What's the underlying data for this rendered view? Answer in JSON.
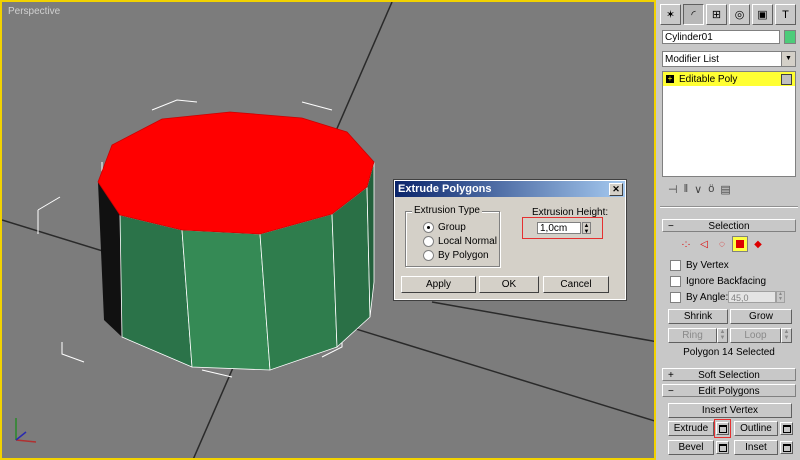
{
  "viewport": {
    "label": "Perspective"
  },
  "dialog": {
    "title": "Extrude Polygons",
    "close": "✕",
    "extrusion_type": {
      "label": "Extrusion Type",
      "options": [
        "Group",
        "Local Normal",
        "By Polygon"
      ],
      "selected": "Group"
    },
    "extrusion_height": {
      "label": "Extrusion Height:",
      "value": "1,0cm"
    },
    "buttons": {
      "apply": "Apply",
      "ok": "OK",
      "cancel": "Cancel"
    }
  },
  "panel": {
    "object_name": "Cylinder01",
    "object_color": "#4ccc7a",
    "modifier_list": "Modifier List",
    "stack": {
      "items": [
        "Editable Poly"
      ]
    },
    "selection": {
      "title": "Selection",
      "by_vertex": "By Vertex",
      "ignore_backfacing": "Ignore Backfacing",
      "by_angle": "By Angle:",
      "angle_value": "45,0",
      "shrink": "Shrink",
      "grow": "Grow",
      "ring": "Ring",
      "loop": "Loop",
      "status": "Polygon 14 Selected"
    },
    "soft_selection": {
      "title": "Soft Selection"
    },
    "edit_polygons": {
      "title": "Edit Polygons",
      "insert_vertex": "Insert Vertex",
      "extrude": "Extrude",
      "outline": "Outline",
      "bevel": "Bevel",
      "inset": "Inset"
    }
  },
  "colors": {
    "highlight": "#e53030",
    "selected_face": "#ff0000",
    "mesh_face": "#2e7d4c",
    "active_border": "#f2d200"
  }
}
